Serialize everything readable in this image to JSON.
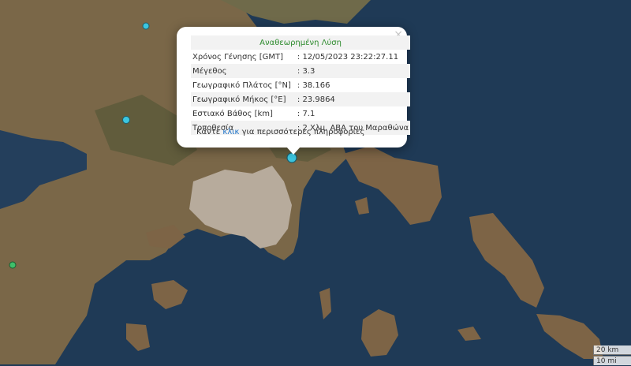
{
  "popup": {
    "title": "Αναθεωρημένη Λύση",
    "close": "×",
    "rows": [
      {
        "label": "Χρόνος Γένησης [GMT]",
        "value": ": 12/05/2023 23:22:27.11"
      },
      {
        "label": "Μέγεθος",
        "value": ": 3.3"
      },
      {
        "label": "Γεωγραφικό Πλάτος [°N]",
        "value": ": 38.166"
      },
      {
        "label": "Γεωγραφικό Μήκος [°E]",
        "value": ": 23.9864"
      },
      {
        "label": "Εστιακό Βάθος [km]",
        "value": ": 7.1"
      },
      {
        "label": "Τοποθεσία",
        "value": ": 2 Χλμ. ΑΒΑ του Μαραθώνα"
      }
    ],
    "more_prefix": "Κάντε ",
    "more_link": "κλικ",
    "more_suffix": " για περισσότερες πληροφορίες"
  },
  "scale": {
    "km": "20 km",
    "mi": "10 mi"
  },
  "colors": {
    "sea": "#1f3a56",
    "land": "#7a6748",
    "urban": "#b7ab9c",
    "quake_marker": "#3cc6e0",
    "quake_marker_green": "#3fbf6a",
    "popup_title": "#2e8b2e",
    "link": "#1e73c8"
  }
}
